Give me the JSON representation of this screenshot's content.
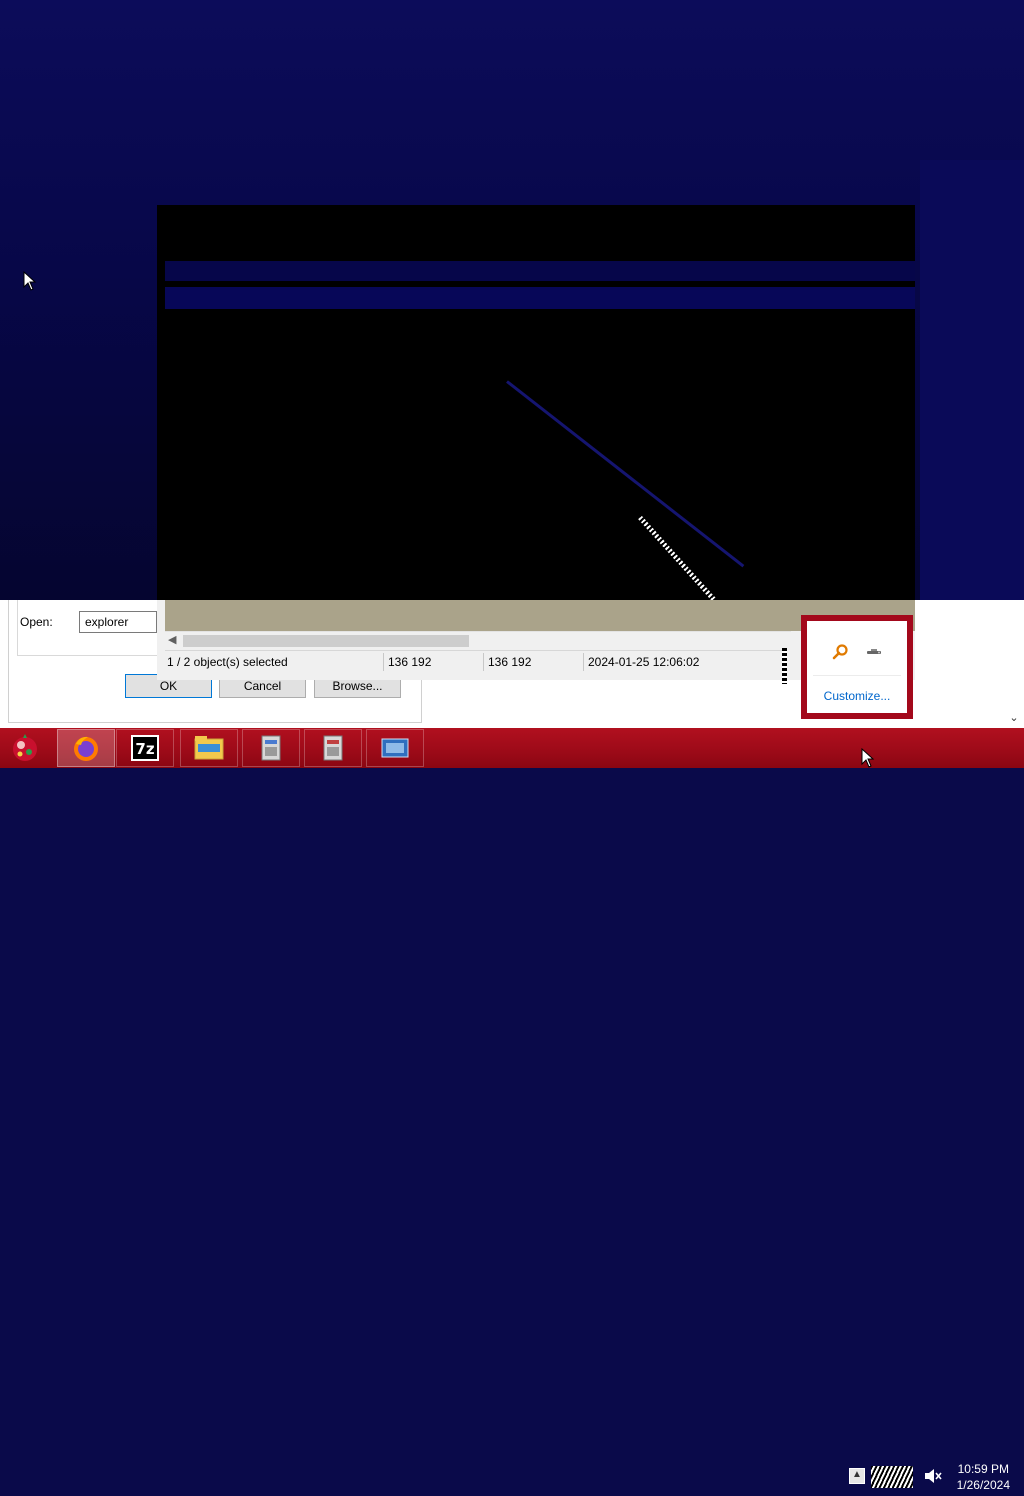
{
  "run_dialog": {
    "open_label": "Open:",
    "open_value": "explorer",
    "ok_label": "OK",
    "cancel_label": "Cancel",
    "browse_label": "Browse..."
  },
  "sevenzip_window": {
    "status": {
      "selection": "1 / 2 object(s) selected",
      "size": "136 192",
      "packed_size": "136 192",
      "modified": "2024-01-25 12:06:02"
    }
  },
  "tray_overflow": {
    "icons": [
      "search-key-icon",
      "remote-device-icon"
    ],
    "customize_label": "Customize..."
  },
  "taskbar": {
    "apps": [
      {
        "name": "firefox",
        "icon": "firefox-icon",
        "active": true
      },
      {
        "name": "7-zip",
        "icon": "7zip-icon",
        "active": false
      },
      {
        "name": "file-explorer",
        "icon": "folder-icon",
        "active": false
      },
      {
        "name": "installer-1",
        "icon": "installer-icon",
        "active": false
      },
      {
        "name": "installer-2",
        "icon": "installer-icon",
        "active": false
      },
      {
        "name": "app-window",
        "icon": "window-app-icon",
        "active": false
      }
    ],
    "clock": {
      "time": "10:59 PM",
      "date": "1/26/2024"
    }
  },
  "colors": {
    "taskbar": "#a30c1a",
    "tray_popup_border": "#a3081b",
    "link": "#0066cc",
    "desktop": "#0a0a4a"
  }
}
